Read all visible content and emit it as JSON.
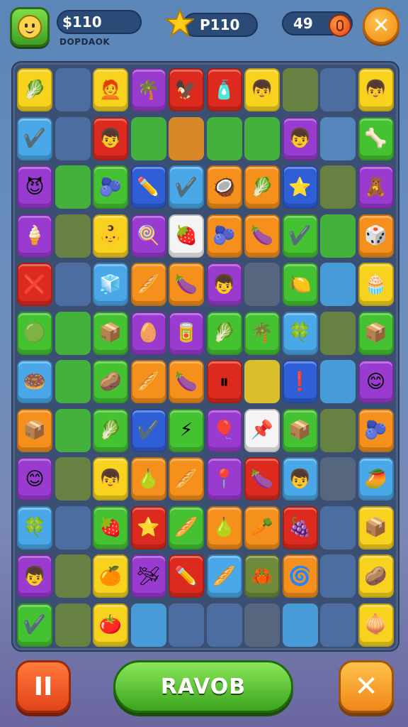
{
  "header": {
    "coins_value": "$110",
    "coins_sublabel": "DOPDAOK",
    "stars_value": "P110",
    "lives_value": "49",
    "close_glyph": "✕"
  },
  "footer": {
    "pause_glyph": "II",
    "main_label": "RAVOB",
    "close_glyph": "✕"
  },
  "colors": {
    "yellow": "#f7d21e",
    "lblue": "#4aa8e8",
    "red": "#dd2a1e",
    "purple": "#9a3bd0",
    "green": "#45c232",
    "orange": "#f5901c",
    "white": "#f4f4f4",
    "dblue": "#2f5fd6",
    "dslate": "#4f72a8",
    "olive": "#6f8a3a",
    "emptyblue": "#5a8fc8",
    "emptygray": "#5a6a80"
  },
  "board": {
    "rows": [
      [
        {
          "c": "yellow",
          "i": "🥬"
        },
        {
          "c": "dslate",
          "i": ""
        },
        {
          "c": "yellow",
          "i": "🧑‍🦰"
        },
        {
          "c": "purple",
          "i": "🌴"
        },
        {
          "c": "red",
          "i": "🦅"
        },
        {
          "c": "red",
          "i": "🧴"
        },
        {
          "c": "yellow",
          "i": "👦"
        },
        {
          "c": "olive",
          "i": ""
        },
        {
          "c": "dslate",
          "i": ""
        },
        {
          "c": "yellow",
          "i": "👦"
        }
      ],
      [
        {
          "c": "lblue",
          "i": "✔️"
        },
        {
          "c": "dslate",
          "i": ""
        },
        {
          "c": "red",
          "i": "👦"
        },
        {
          "c": "green",
          "i": ""
        },
        {
          "c": "orange",
          "i": ""
        },
        {
          "c": "green",
          "i": ""
        },
        {
          "c": "green",
          "i": ""
        },
        {
          "c": "purple",
          "i": "👦"
        },
        {
          "c": "emptyblue",
          "i": ""
        },
        {
          "c": "green",
          "i": "🦴"
        }
      ],
      [
        {
          "c": "purple",
          "i": "😈"
        },
        {
          "c": "green",
          "i": ""
        },
        {
          "c": "green",
          "i": "🫐"
        },
        {
          "c": "dblue",
          "i": "✏️"
        },
        {
          "c": "lblue",
          "i": "✔️"
        },
        {
          "c": "orange",
          "i": "🥥"
        },
        {
          "c": "orange",
          "i": "🥬"
        },
        {
          "c": "dblue",
          "i": "⭐"
        },
        {
          "c": "olive",
          "i": ""
        },
        {
          "c": "purple",
          "i": "🧸"
        }
      ],
      [
        {
          "c": "purple",
          "i": "🍦"
        },
        {
          "c": "olive",
          "i": ""
        },
        {
          "c": "yellow",
          "i": "👶"
        },
        {
          "c": "purple",
          "i": "🍭"
        },
        {
          "c": "white",
          "i": "🍓"
        },
        {
          "c": "orange",
          "i": "🫐"
        },
        {
          "c": "orange",
          "i": "🍆"
        },
        {
          "c": "green",
          "i": "✔️"
        },
        {
          "c": "green",
          "i": ""
        },
        {
          "c": "orange",
          "i": "🎲"
        }
      ],
      [
        {
          "c": "red",
          "i": "❌"
        },
        {
          "c": "dslate",
          "i": ""
        },
        {
          "c": "lblue",
          "i": "🧊"
        },
        {
          "c": "orange",
          "i": "🥖"
        },
        {
          "c": "orange",
          "i": "🍆"
        },
        {
          "c": "purple",
          "i": "👦"
        },
        {
          "c": "emptygray",
          "i": ""
        },
        {
          "c": "green",
          "i": "🍋"
        },
        {
          "c": "lblue",
          "i": ""
        },
        {
          "c": "yellow",
          "i": "🧁"
        }
      ],
      [
        {
          "c": "green",
          "i": "🟢"
        },
        {
          "c": "green",
          "i": ""
        },
        {
          "c": "green",
          "i": "📦"
        },
        {
          "c": "purple",
          "i": "🥚"
        },
        {
          "c": "purple",
          "i": "🥫"
        },
        {
          "c": "green",
          "i": "🥬"
        },
        {
          "c": "green",
          "i": "🌴"
        },
        {
          "c": "lblue",
          "i": "🍀"
        },
        {
          "c": "olive",
          "i": ""
        },
        {
          "c": "green",
          "i": "📦"
        }
      ],
      [
        {
          "c": "lblue",
          "i": "🍩"
        },
        {
          "c": "green",
          "i": ""
        },
        {
          "c": "green",
          "i": "🥔"
        },
        {
          "c": "orange",
          "i": "🥖"
        },
        {
          "c": "orange",
          "i": "🍆"
        },
        {
          "c": "red",
          "i": "⏸"
        },
        {
          "c": "yellow",
          "i": ""
        },
        {
          "c": "dblue",
          "i": "❗"
        },
        {
          "c": "lblue",
          "i": ""
        },
        {
          "c": "purple",
          "i": "😊"
        }
      ],
      [
        {
          "c": "orange",
          "i": "📦"
        },
        {
          "c": "green",
          "i": ""
        },
        {
          "c": "green",
          "i": "🥬"
        },
        {
          "c": "dblue",
          "i": "✔️"
        },
        {
          "c": "green",
          "i": "⚡"
        },
        {
          "c": "purple",
          "i": "🎈"
        },
        {
          "c": "white",
          "i": "📌"
        },
        {
          "c": "green",
          "i": "📦"
        },
        {
          "c": "olive",
          "i": ""
        },
        {
          "c": "orange",
          "i": "🫐"
        }
      ],
      [
        {
          "c": "purple",
          "i": "😊"
        },
        {
          "c": "olive",
          "i": ""
        },
        {
          "c": "yellow",
          "i": "👦"
        },
        {
          "c": "orange",
          "i": "🍐"
        },
        {
          "c": "orange",
          "i": "🥖"
        },
        {
          "c": "purple",
          "i": "📍"
        },
        {
          "c": "red",
          "i": "🍆"
        },
        {
          "c": "lblue",
          "i": "👦"
        },
        {
          "c": "emptygray",
          "i": ""
        },
        {
          "c": "lblue",
          "i": "🥭"
        }
      ],
      [
        {
          "c": "lblue",
          "i": "🍀"
        },
        {
          "c": "dslate",
          "i": ""
        },
        {
          "c": "green",
          "i": "🍓"
        },
        {
          "c": "red",
          "i": "⭐"
        },
        {
          "c": "green",
          "i": "🥖"
        },
        {
          "c": "orange",
          "i": "🍐"
        },
        {
          "c": "orange",
          "i": "🥕"
        },
        {
          "c": "red",
          "i": "🍇"
        },
        {
          "c": "dslate",
          "i": ""
        },
        {
          "c": "yellow",
          "i": "📦"
        }
      ],
      [
        {
          "c": "purple",
          "i": "👦"
        },
        {
          "c": "olive",
          "i": ""
        },
        {
          "c": "yellow",
          "i": "🍊"
        },
        {
          "c": "purple",
          "i": "🛩"
        },
        {
          "c": "red",
          "i": "✏️"
        },
        {
          "c": "lblue",
          "i": "🥖"
        },
        {
          "c": "olive",
          "i": "🦀"
        },
        {
          "c": "orange",
          "i": "🌀"
        },
        {
          "c": "dslate",
          "i": ""
        },
        {
          "c": "yellow",
          "i": "🥔"
        }
      ],
      [
        {
          "c": "green",
          "i": "✔️"
        },
        {
          "c": "olive",
          "i": ""
        },
        {
          "c": "yellow",
          "i": "🍅"
        },
        {
          "c": "lblue",
          "i": ""
        },
        {
          "c": "dslate",
          "i": ""
        },
        {
          "c": "dslate",
          "i": ""
        },
        {
          "c": "emptygray",
          "i": ""
        },
        {
          "c": "lblue",
          "i": ""
        },
        {
          "c": "dslate",
          "i": ""
        },
        {
          "c": "yellow",
          "i": "🧅"
        }
      ]
    ]
  }
}
